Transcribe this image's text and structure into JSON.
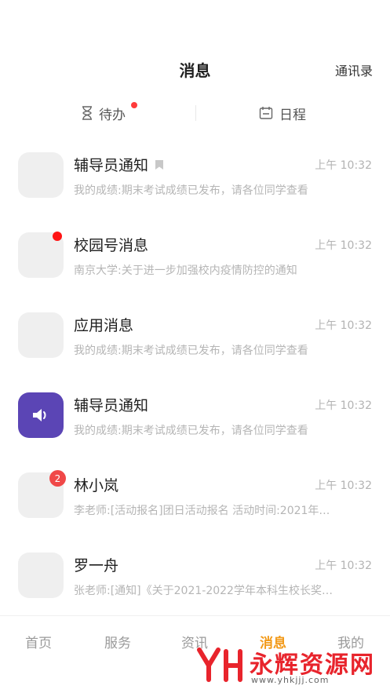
{
  "header": {
    "title": "消息",
    "contacts_label": "通讯录"
  },
  "quick_tabs": {
    "todo_label": "待办",
    "schedule_label": "日程"
  },
  "messages": [
    {
      "name": "辅导员通知",
      "time": "上午 10:32",
      "preview": "我的成绩:期末考试成绩已发布，请各位同学查看"
    },
    {
      "name": "校园号消息",
      "time": "上午 10:32",
      "preview": "南京大学:关于进一步加强校内疫情防控的通知"
    },
    {
      "name": "应用消息",
      "time": "上午 10:32",
      "preview": "我的成绩:期末考试成绩已发布，请各位同学查看"
    },
    {
      "name": "辅导员通知",
      "time": "上午 10:32",
      "preview": "我的成绩:期末考试成绩已发布，请各位同学查看"
    },
    {
      "name": "林小岚",
      "time": "上午 10:32",
      "preview": "李老师:[活动报名]团日活动报名 活动时间:2021年…",
      "badge": "2"
    },
    {
      "name": "罗一舟",
      "time": "上午 10:32",
      "preview": "张老师:[通知]《关于2021-2022学年本科生校长奖…"
    }
  ],
  "tabbar": {
    "home": "首页",
    "service": "服务",
    "news": "资讯",
    "messages": "消息",
    "me": "我的"
  },
  "colors": {
    "accent": "#f29a1a",
    "badge": "#ff1414",
    "speaker_avatar": "#5b45b5"
  },
  "watermark": {
    "text": "永辉资源网",
    "url": "www.yhkjjj.com"
  }
}
